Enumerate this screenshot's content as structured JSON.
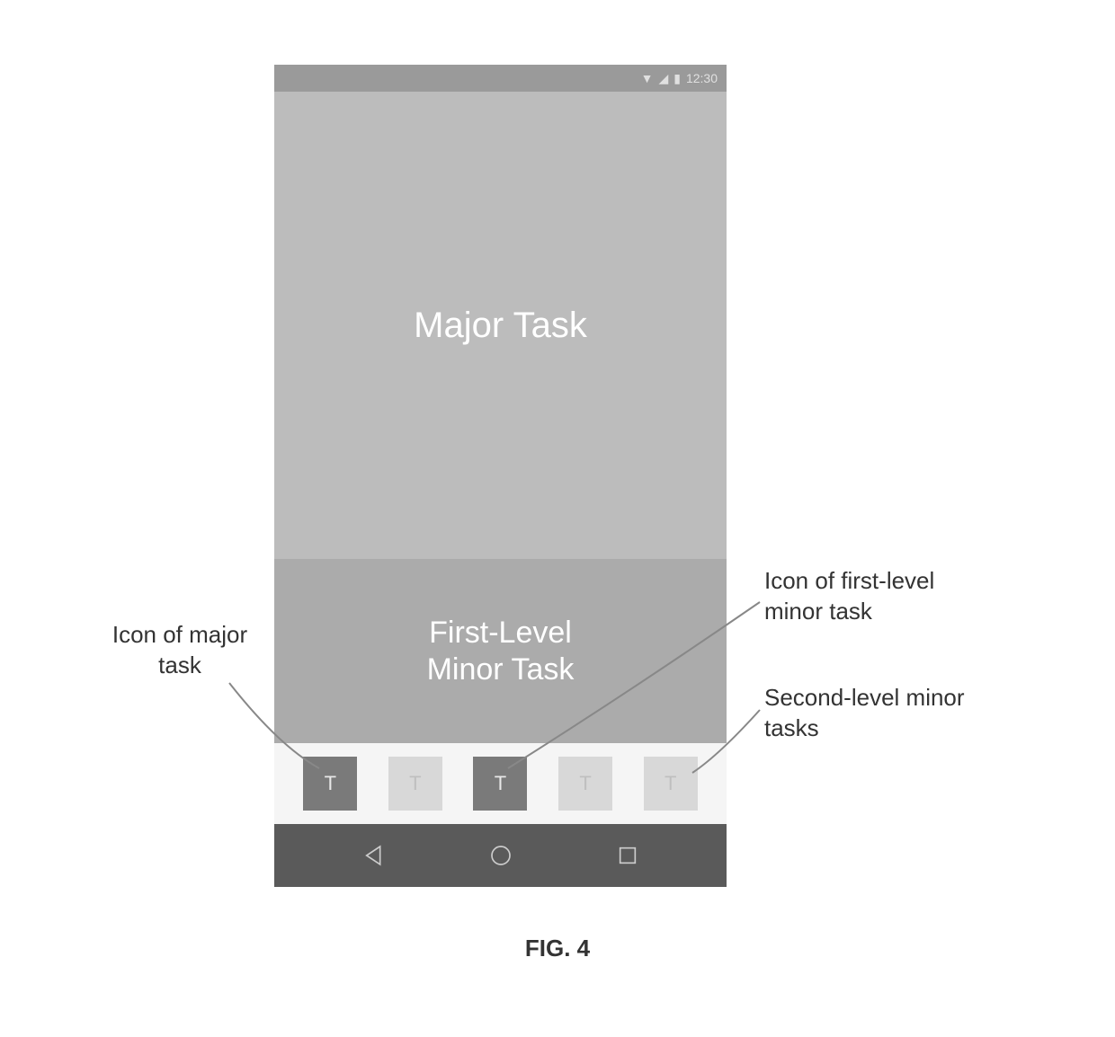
{
  "status": {
    "time": "12:30"
  },
  "screen": {
    "major_task_label": "Major Task",
    "first_level_label_line1": "First-Level",
    "first_level_label_line2": "Minor Task"
  },
  "task_icons": {
    "letter": "T"
  },
  "callouts": {
    "major_icon": "Icon of major task",
    "first_level_icon": "Icon of first-level minor task",
    "second_level": "Second-level minor tasks"
  },
  "figure": {
    "caption": "FIG. 4"
  }
}
